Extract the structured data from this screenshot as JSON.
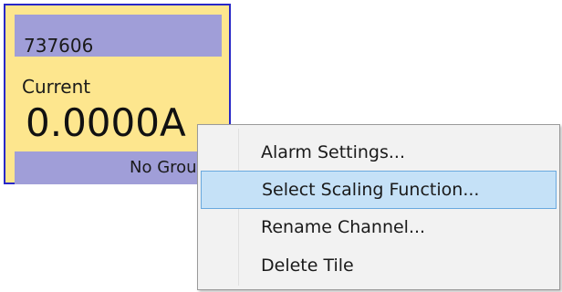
{
  "tile": {
    "channel_id": "737606",
    "measurement_label": "Current",
    "value": "0.0000A",
    "group": "No Group",
    "colors": {
      "border": "#2828c8",
      "body": "#fde68e",
      "header": "#a09ed8"
    }
  },
  "context_menu": {
    "items": [
      {
        "label": "Alarm Settings..."
      },
      {
        "label": "Select Scaling Function...",
        "selected": true
      },
      {
        "label": "Rename Channel..."
      },
      {
        "label": "Delete Tile"
      }
    ],
    "colors": {
      "background": "#f2f2f2",
      "highlight": "#c5e1f7",
      "highlight_border": "#6aa9de"
    }
  }
}
